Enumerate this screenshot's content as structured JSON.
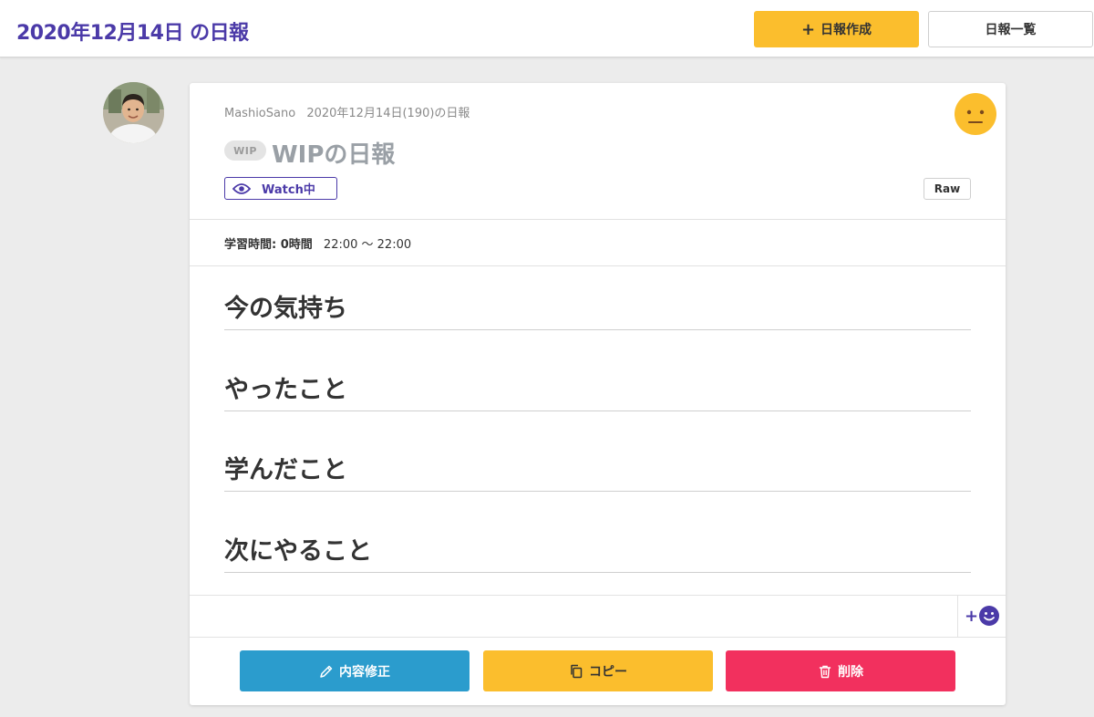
{
  "header": {
    "title": "2020年12月14日 の日報",
    "create_label": "日報作成",
    "list_label": "日報一覧"
  },
  "report": {
    "user": "MashioSano",
    "date_info": "2020年12月14日(190)の日報",
    "wip_badge": "WIP",
    "title": "WIPの日報",
    "watch_label": "Watch中",
    "raw_label": "Raw",
    "study_time_label": "学習時間: 0時間",
    "study_time_range": "22:00 〜 22:00",
    "sections": [
      "今の気持ち",
      "やったこと",
      "学んだこと",
      "次にやること"
    ]
  },
  "reaction": {
    "add_label": "+"
  },
  "actions": {
    "edit_label": "内容修正",
    "copy_label": "コピー",
    "delete_label": "削除"
  },
  "colors": {
    "brand": "#4b3aa8",
    "yellow": "#fbbe2d",
    "blue": "#2b9ccd",
    "red": "#f2305e"
  },
  "icons": {
    "create": "plus-icon",
    "watch": "eye-icon",
    "mood": "neutral-face-icon",
    "reaction": "smiley-icon",
    "edit": "pencil-icon",
    "copy": "copy-icon",
    "delete": "trash-icon"
  }
}
